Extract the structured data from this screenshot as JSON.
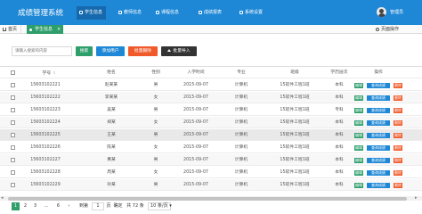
{
  "app": {
    "title": "成绩管理系统"
  },
  "nav": [
    {
      "label": "学生信息"
    },
    {
      "label": "教师信息"
    },
    {
      "label": "课程信息"
    },
    {
      "label": "成绩报表"
    },
    {
      "label": "系统设置"
    }
  ],
  "user": {
    "name": "管理员"
  },
  "tabs": {
    "home": "首页",
    "students": "学生信息",
    "close": "×",
    "page_ops": "页面操作"
  },
  "toolbar": {
    "search_placeholder": "请输入搜索的内容",
    "search": "搜索",
    "add": "添加用户",
    "batch_delete": "批量删除",
    "batch_import": "批量导入"
  },
  "table": {
    "headers": [
      "学号",
      "姓名",
      "性别",
      "入学时间",
      "专业",
      "班级",
      "学历层次",
      "操作"
    ],
    "sort_glyph": "⇕",
    "rows": [
      [
        "15603102221",
        "赵某某",
        "男",
        "2015-09-07",
        "计算机",
        "15软件工程1班",
        "本科"
      ],
      [
        "15603102222",
        "李某某",
        "女",
        "2015-09-07",
        "计算机",
        "15软件工程1班",
        "本科"
      ],
      [
        "15603102223",
        "吴某",
        "男",
        "2015-09-07",
        "计算机",
        "15软件工程1班",
        "专科"
      ],
      [
        "15603102224",
        "郑某",
        "女",
        "2015-09-07",
        "计算机",
        "15软件工程1班",
        "本科"
      ],
      [
        "15603102225",
        "王某",
        "男",
        "2015-09-07",
        "计算机",
        "15软件工程1班",
        "本科"
      ],
      [
        "15603102226",
        "陈某",
        "女",
        "2015-09-07",
        "计算机",
        "15软件工程1班",
        "本科"
      ],
      [
        "15603102227",
        "黄某",
        "男",
        "2015-09-07",
        "计算机",
        "15软件工程1班",
        "本科"
      ],
      [
        "15603102228",
        "周某",
        "女",
        "2015-09-07",
        "计算机",
        "15软件工程1班",
        "本科"
      ],
      [
        "15603102229",
        "孙某",
        "男",
        "2015-09-07",
        "计算机",
        "15软件工程1班",
        "本科"
      ]
    ],
    "actions": {
      "edit": "编辑",
      "grade": "查询成绩",
      "delete": "删除"
    }
  },
  "scroll": {
    "left": "◂",
    "right": "▸"
  },
  "pagination": {
    "current": "1",
    "p2": "2",
    "p3": "3",
    "ellipsis": "...",
    "last": "6",
    "next": "›",
    "goto_label": "到第",
    "page_value": "1",
    "page_suffix": "页",
    "confirm": "确定",
    "total": "共 72 条",
    "per_page": "10 条/页 ▾"
  },
  "colors": {
    "topbar": "#1e88d6",
    "green": "#2e9e6b",
    "blue": "#1e88d6",
    "orange": "#f05a2a",
    "dark": "#333333"
  },
  "icons": {
    "nav": "grid-icon",
    "home": "home-icon",
    "user": "avatar-icon",
    "import": "upload-icon"
  }
}
